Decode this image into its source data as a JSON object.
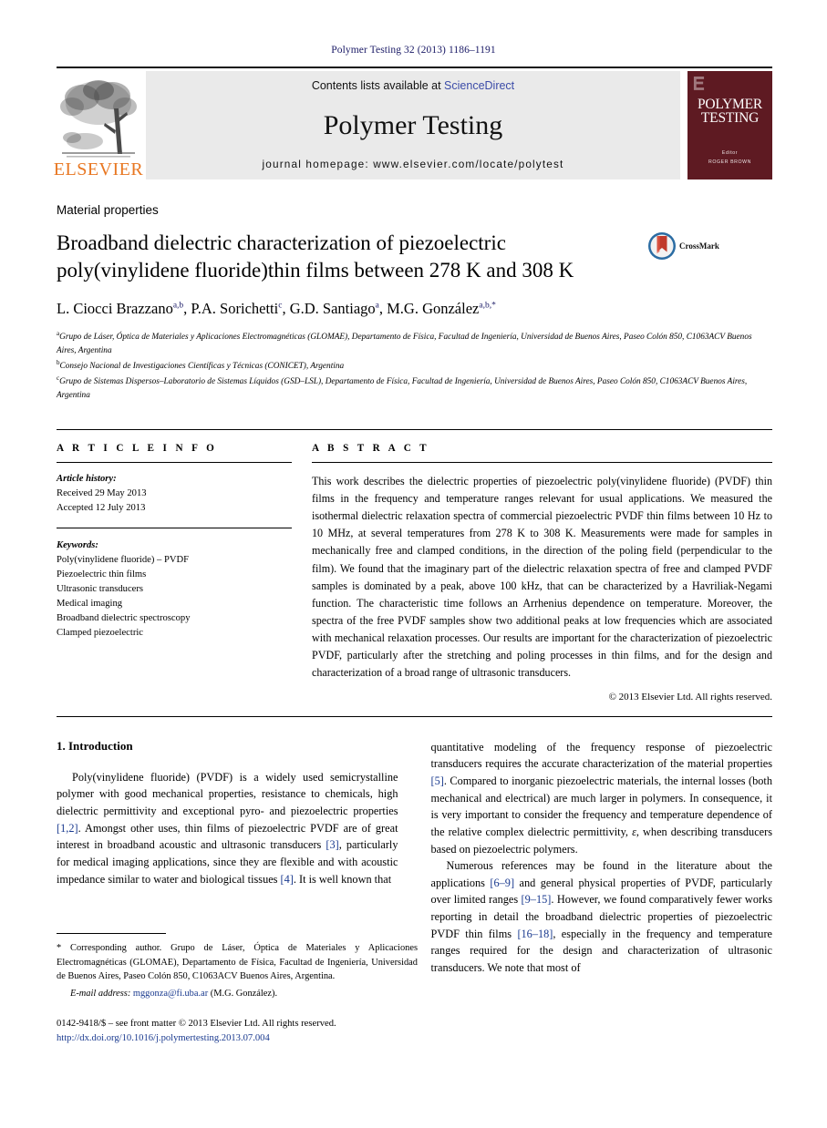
{
  "running_head": "Polymer Testing 32 (2013) 1186–1191",
  "masthead": {
    "publisher_name": "ELSEVIER",
    "contents_prefix": "Contents lists available at ",
    "sciencedirect": "ScienceDirect",
    "journal_name": "Polymer Testing",
    "homepage": "journal homepage: www.elsevier.com/locate/polytest",
    "cover": {
      "title_line1": "POLYMER",
      "title_line2": "TESTING",
      "editor_label": "Editor",
      "editor_name": "ROGER BROWN"
    }
  },
  "article": {
    "section_label": "Material properties",
    "title_line1": "Broadband dielectric characterization of piezoelectric",
    "title_line2": "poly(vinylidene fluoride)thin films between 278 K and 308 K",
    "crossmark_label": "CrossMark",
    "authors": [
      {
        "name": "L. Ciocci Brazzano",
        "sup": "a,b",
        "sep": ", "
      },
      {
        "name": "P.A. Sorichetti",
        "sup": "c",
        "sep": ", "
      },
      {
        "name": "G.D. Santiago",
        "sup": "a",
        "sep": ", "
      },
      {
        "name": "M.G. González",
        "sup": "a,b,",
        "sep": ""
      }
    ],
    "affiliations": [
      {
        "mark": "a",
        "text": "Grupo de Láser, Óptica de Materiales y Aplicaciones Electromagnéticas (GLOMAE), Departamento de Física, Facultad de Ingeniería, Universidad de Buenos Aires, Paseo Colón 850, C1063ACV Buenos Aires, Argentina"
      },
      {
        "mark": "b",
        "text": "Consejo Nacional de Investigaciones Científicas y Técnicas (CONICET), Argentina"
      },
      {
        "mark": "c",
        "text": "Grupo de Sistemas Dispersos–Laboratorio de Sistemas Líquidos (GSD–LSL), Departamento de Física, Facultad de Ingeniería, Universidad de Buenos Aires, Paseo Colón 850, C1063ACV Buenos Aires, Argentina"
      }
    ]
  },
  "article_info": {
    "heading": "A R T I C L E    I N F O",
    "history_label": "Article history:",
    "received": "Received 29 May 2013",
    "accepted": "Accepted 12 July 2013",
    "keywords_label": "Keywords:",
    "keywords": [
      "Poly(vinylidene fluoride) – PVDF",
      "Piezoelectric thin films",
      "Ultrasonic transducers",
      "Medical imaging",
      "Broadband dielectric spectroscopy",
      "Clamped piezoelectric"
    ]
  },
  "abstract": {
    "heading": "A B S T R A C T",
    "text": "This work describes the dielectric properties of piezoelectric poly(vinylidene fluoride) (PVDF) thin films in the frequency and temperature ranges relevant for usual applications. We measured the isothermal dielectric relaxation spectra of commercial piezoelectric PVDF thin films between 10 Hz to 10 MHz, at several temperatures from 278 K to 308 K. Measurements were made for samples in mechanically free and clamped conditions, in the direction of the poling field (perpendicular to the film). We found that the imaginary part of the dielectric relaxation spectra of free and clamped PVDF samples is dominated by a peak, above 100 kHz, that can be characterized by a Havriliak-Negami function. The characteristic time follows an Arrhenius dependence on temperature. Moreover, the spectra of the free PVDF samples show two additional peaks at low frequencies which are associated with mechanical relaxation processes. Our results are important for the characterization of piezoelectric PVDF, particularly after the stretching and poling processes in thin films, and for the design and characterization of a broad range of ultrasonic transducers.",
    "copyright": "© 2013 Elsevier Ltd. All rights reserved."
  },
  "introduction": {
    "heading": "1. Introduction",
    "left_para_1_a": "Poly(vinylidene fluoride) (PVDF) is a widely used semicrystalline polymer with good mechanical properties, resistance to chemicals, high dielectric permittivity and exceptional pyro- and piezoelectric properties ",
    "left_cite_1": "[1,2]",
    "left_para_1_b": ". Amongst other uses, thin films of piezoelectric PVDF are of great interest in broadband acoustic and ultrasonic transducers ",
    "left_cite_2": "[3]",
    "left_para_1_c": ", particularly for medical imaging applications, since they are flexible and with acoustic impedance similar to water and biological tissues ",
    "left_cite_3": "[4]",
    "left_para_1_d": ". It is well known that",
    "right_para_1_a": "quantitative modeling of the frequency response of piezoelectric transducers requires the accurate characterization of the material properties ",
    "right_cite_1": "[5]",
    "right_para_1_b": ". Compared to inorganic piezoelectric materials, the internal losses (both mechanical and electrical) are much larger in polymers. In consequence, it is very important to consider the frequency and temperature dependence of the relative complex dielectric permittivity, ",
    "right_epsilon": "ε",
    "right_para_1_c": ", when describing transducers based on piezoelectric polymers.",
    "right_para_2_a": "Numerous references may be found in the literature about the applications ",
    "right_cite_2": "[6–9]",
    "right_para_2_b": " and general physical properties of PVDF, particularly over limited ranges ",
    "right_cite_3": "[9–15]",
    "right_para_2_c": ". However, we found comparatively fewer works reporting in detail the broadband dielectric properties of piezoelectric PVDF thin films ",
    "right_cite_4": "[16–18]",
    "right_para_2_d": ", especially in the frequency and temperature ranges required for the design and characterization of ultrasonic transducers. We note that most of"
  },
  "footnote": {
    "text": "* Corresponding author. Grupo de Láser, Óptica de Materiales y Aplicaciones Electromagnéticas (GLOMAE), Departamento de Física, Facultad de Ingeniería, Universidad de Buenos Aires, Paseo Colón 850, C1063ACV Buenos Aires, Argentina.",
    "email_label": "E-mail address:",
    "email": "mggonza@fi.uba.ar",
    "email_owner": "(M.G. González)."
  },
  "footer": {
    "issn_line": "0142-9418/$ – see front matter © 2013 Elsevier Ltd. All rights reserved.",
    "doi": "http://dx.doi.org/10.1016/j.polymertesting.2013.07.004"
  },
  "colors": {
    "running_head": "#1a1a66",
    "link": "#1a3a8f",
    "sciencedirect": "#3b4ba8",
    "elsevier_orange": "#e87722",
    "cover_maroon": "#5e1a22",
    "masthead_gray": "#eaeaea"
  }
}
